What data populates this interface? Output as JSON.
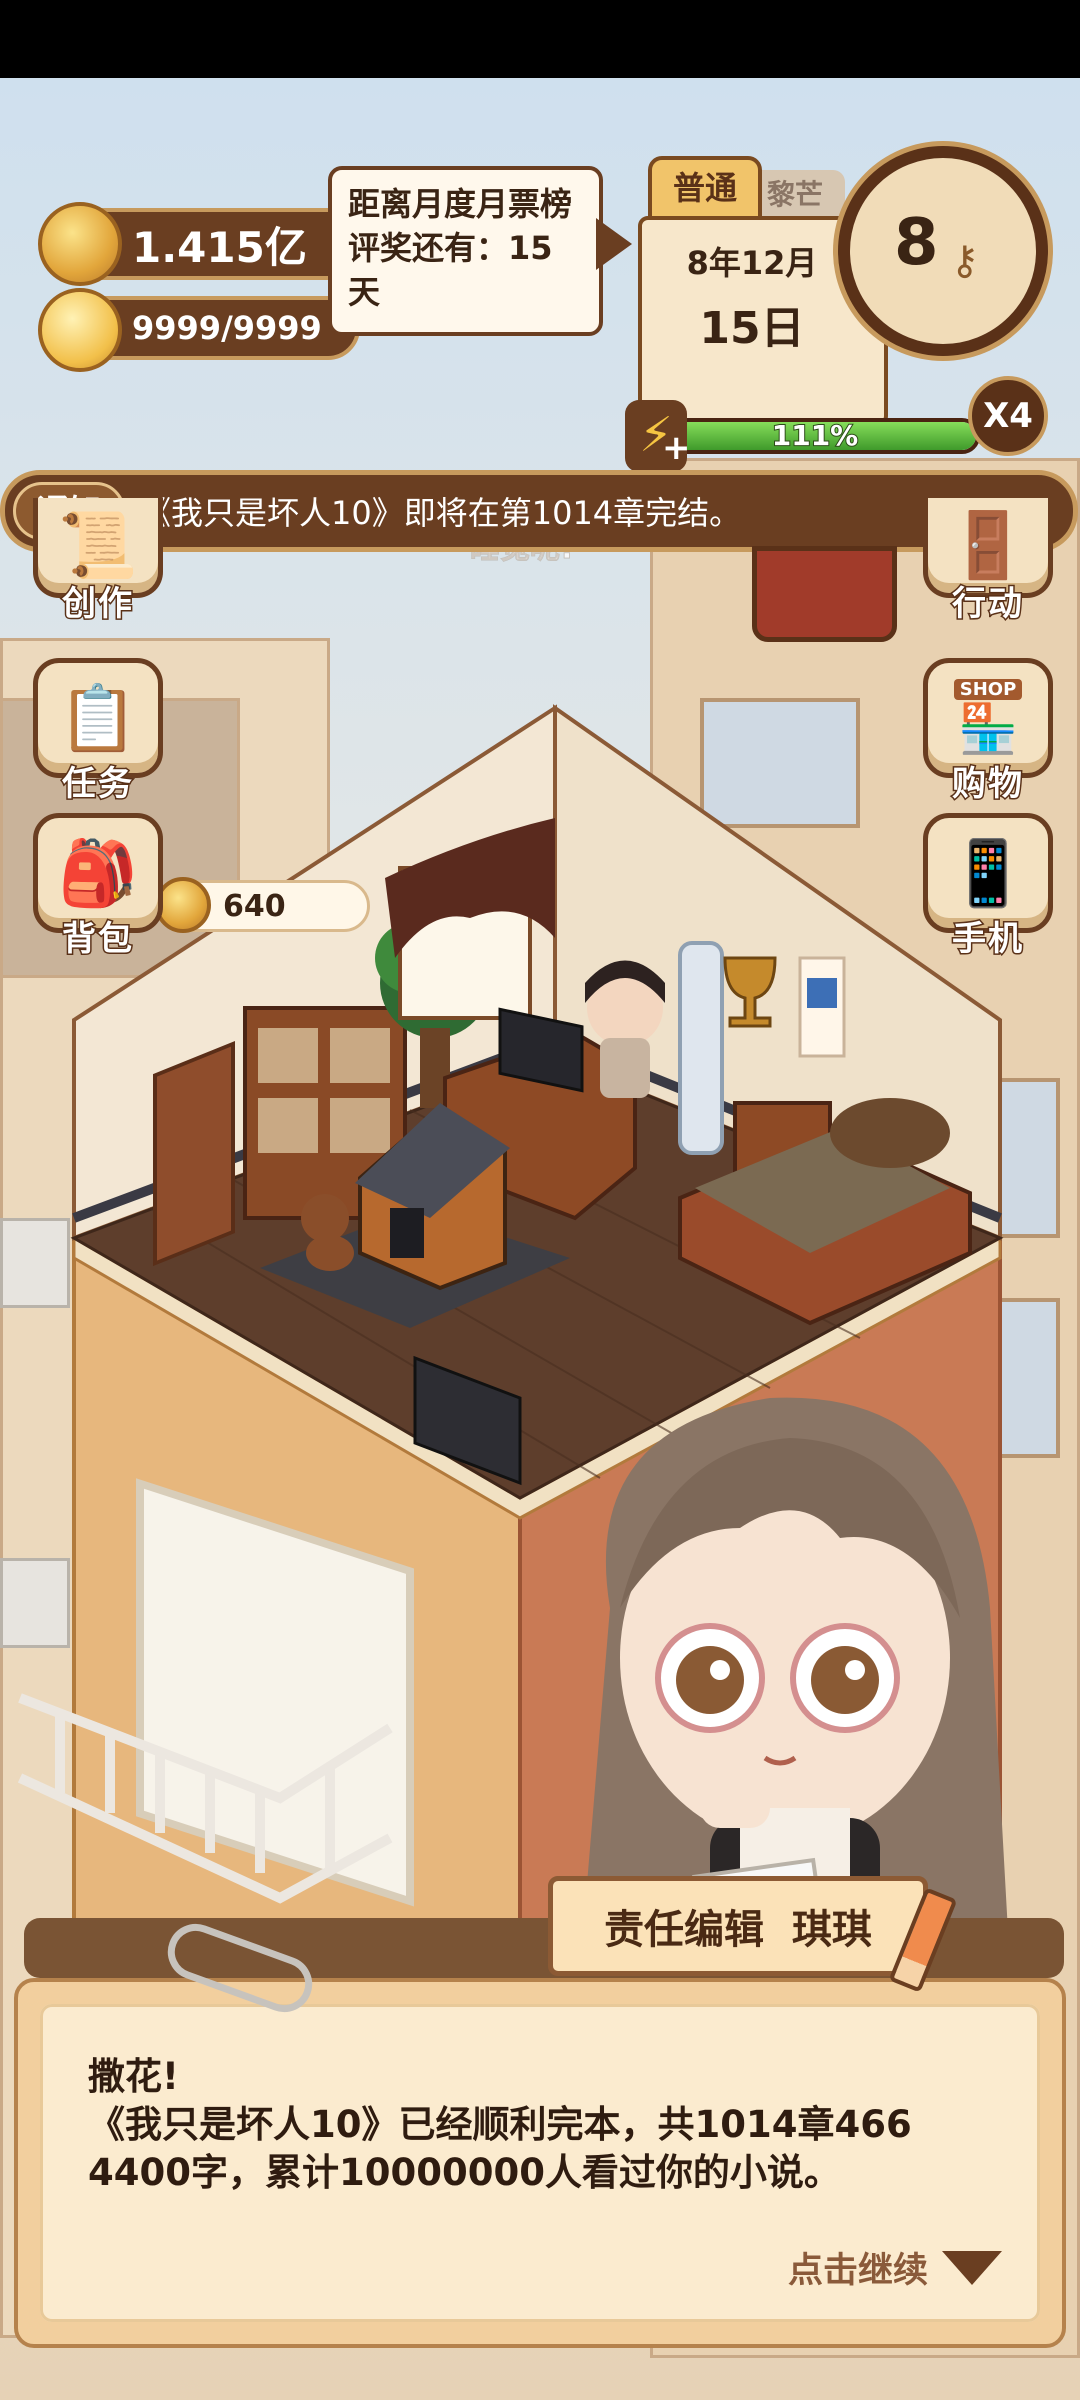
{
  "hud": {
    "money": "1.415亿",
    "energy": "9999/9999",
    "tooltip": "距离月度月票榜评奖还有：15天",
    "tier_tab": "普通",
    "tier_tab_back": "黎芒",
    "date_month": "8年12月",
    "date_day": "15日",
    "progress_label": "111%",
    "progress_fraction": 1.0,
    "action_points": "8",
    "multiplier": "X4"
  },
  "notice": {
    "tag": "通知",
    "text": "《我只是坏人10》即将在第1014章完结。"
  },
  "menu_left": [
    {
      "label": "创作",
      "icon": "manuscript-icon"
    },
    {
      "label": "任务",
      "icon": "checklist-icon"
    },
    {
      "label": "背包",
      "icon": "backpack-icon"
    }
  ],
  "menu_right": [
    {
      "label": "行动",
      "icon": "door-icon"
    },
    {
      "label": "购物",
      "icon": "shop-icon"
    },
    {
      "label": "手机",
      "icon": "phone-icon"
    }
  ],
  "shop_sign": "SHOP",
  "status_text": "睡觉呢!",
  "room_coin": "640",
  "dialog": {
    "speaker": "责任编辑  琪琪",
    "line1": "撒花!",
    "line2": "《我只是坏人10》已经顺利完本，共1014章466",
    "line3": "4400字，累计10000000人看过你的小说。",
    "continue": "点击继续"
  },
  "colors": {
    "wood_dark": "#6a3e21",
    "gold": "#c79a5d",
    "parchment": "#f6e3c4",
    "progress_green": "#4fb63d"
  }
}
